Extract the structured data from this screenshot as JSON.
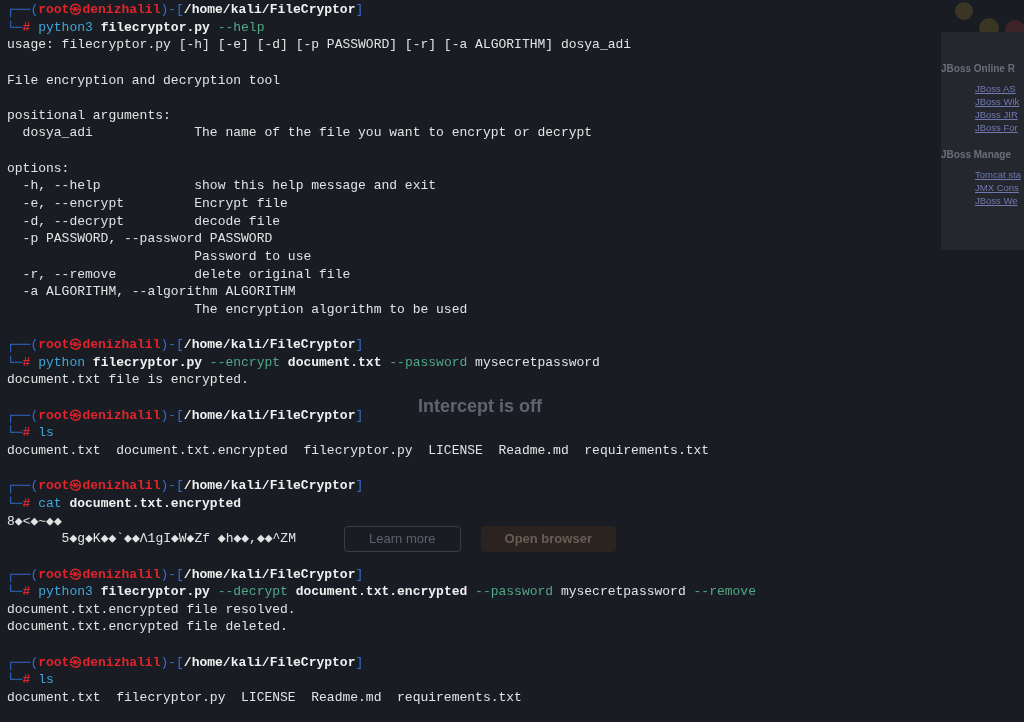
{
  "background_window": {
    "title": "Intercept is off",
    "buttons": [
      "Learn more",
      "Open browser"
    ]
  },
  "background_page": {
    "sections": [
      {
        "heading": "JBoss Online R",
        "links": [
          "JBoss AS",
          "JBoss Wik",
          "JBoss JIR",
          "JBoss For"
        ]
      },
      {
        "heading": "JBoss Manage",
        "links": [
          "Tomcat sta",
          "JMX Cons",
          "JBoss We"
        ]
      }
    ]
  },
  "terminal": {
    "blocks": [
      {
        "prompt": {
          "open": "┌──(",
          "user": "root㉿denizhalil",
          "mid": ")-[",
          "path": "/home/kali/FileCryptor",
          "close": "]",
          "corner": "└─",
          "symbol": "#"
        },
        "command": [
          {
            "kind": "program",
            "text": "python3"
          },
          {
            "kind": "path",
            "text": "filecryptor.py"
          },
          {
            "kind": "option",
            "text": "--help"
          }
        ],
        "output": [
          [
            "usage: filecryptor.py [-h] [-e] [-d] [-p PASSWORD] [-r] [-a ALGORITHM] dosya_adi"
          ],
          [
            "File encryption and decryption tool"
          ],
          [
            "positional arguments:",
            "  dosya_adi             The name of the file you want to encrypt or decrypt"
          ],
          [
            "options:",
            "  -h, --help            show this help message and exit",
            "  -e, --encrypt         Encrypt file",
            "  -d, --decrypt         decode file",
            "  -p PASSWORD, --password PASSWORD",
            "                        Password to use",
            "  -r, --remove          delete original file",
            "  -a ALGORITHM, --algorithm ALGORITHM",
            "                        The encryption algorithm to be used"
          ]
        ]
      },
      {
        "prompt": {
          "open": "┌──(",
          "user": "root㉿denizhalil",
          "mid": ")-[",
          "path": "/home/kali/FileCryptor",
          "close": "]",
          "corner": "└─",
          "symbol": "#"
        },
        "command": [
          {
            "kind": "program",
            "text": "python"
          },
          {
            "kind": "path",
            "text": "filecryptor.py"
          },
          {
            "kind": "option",
            "text": "--encrypt"
          },
          {
            "kind": "path",
            "text": "document.txt"
          },
          {
            "kind": "option",
            "text": "--password"
          },
          {
            "kind": "text",
            "text": "mysecretpassword"
          }
        ],
        "output": [
          [
            "document.txt file is encrypted."
          ]
        ]
      },
      {
        "prompt": {
          "open": "┌──(",
          "user": "root㉿denizhalil",
          "mid": ")-[",
          "path": "/home/kali/FileCryptor",
          "close": "]",
          "corner": "└─",
          "symbol": "#"
        },
        "command": [
          {
            "kind": "program",
            "text": "ls"
          }
        ],
        "output": [
          [
            "document.txt  document.txt.encrypted  filecryptor.py  LICENSE  Readme.md  requirements.txt"
          ]
        ]
      },
      {
        "prompt": {
          "open": "┌──(",
          "user": "root㉿denizhalil",
          "mid": ")-[",
          "path": "/home/kali/FileCryptor",
          "close": "]",
          "corner": "└─",
          "symbol": "#"
        },
        "command": [
          {
            "kind": "program",
            "text": "cat"
          },
          {
            "kind": "path",
            "text": "document.txt.encrypted"
          }
        ],
        "output": [
          [
            "8◆<◆~◆◆",
            "       5◆g◆K◆◆`◆◆Λ1gI◆W◆Zf ◆h◆◆,◆◆^ZM"
          ]
        ]
      },
      {
        "prompt": {
          "open": "┌──(",
          "user": "root㉿denizhalil",
          "mid": ")-[",
          "path": "/home/kali/FileCryptor",
          "close": "]",
          "corner": "└─",
          "symbol": "#"
        },
        "command": [
          {
            "kind": "program",
            "text": "python3"
          },
          {
            "kind": "path",
            "text": "filecryptor.py"
          },
          {
            "kind": "option",
            "text": "--decrypt"
          },
          {
            "kind": "path",
            "text": "document.txt.encrypted"
          },
          {
            "kind": "option",
            "text": "--password"
          },
          {
            "kind": "text",
            "text": "mysecretpassword"
          },
          {
            "kind": "option",
            "text": "--remove"
          }
        ],
        "output": [
          [
            "document.txt.encrypted file resolved.",
            "document.txt.encrypted file deleted."
          ]
        ]
      },
      {
        "prompt": {
          "open": "┌──(",
          "user": "root㉿denizhalil",
          "mid": ")-[",
          "path": "/home/kali/FileCryptor",
          "close": "]",
          "corner": "└─",
          "symbol": "#"
        },
        "command": [
          {
            "kind": "program",
            "text": "ls"
          }
        ],
        "output": [
          [
            "document.txt  filecryptor.py  LICENSE  Readme.md  requirements.txt"
          ]
        ]
      }
    ]
  }
}
